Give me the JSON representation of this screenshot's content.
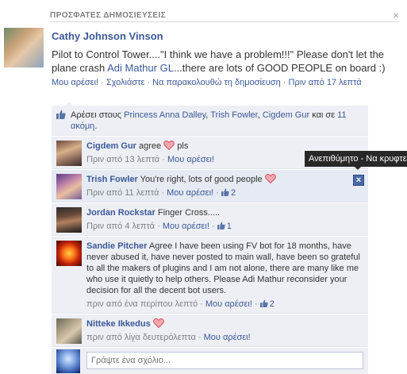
{
  "section": {
    "title": "ΠΡΟΣΦΑΤΕΣ ΔΗΜΟΣΙΕΥΣΕΙΣ",
    "close_glyph": "×"
  },
  "post": {
    "author": "Cathy Johnson Vinson",
    "text_before": "Pilot to Control Tower....\"I think we have a problem!!!\" Please don't let the plane crash ",
    "mention": "Adi Mathur GL",
    "text_after": "...there are lots of GOOD PEOPLE on board :)",
    "actions": {
      "like": "Μου αρέσει!",
      "comment": "Σχολιάστε",
      "follow": "Να παρακολουθώ τη δημοσίευση",
      "time": "Πριν από 17 λεπτά",
      "sep": " · "
    }
  },
  "likes": {
    "prefix": "Αρέσει στους ",
    "people": [
      "Princess Anna Dalley",
      "Trish Fowler",
      "Cigdem Gur"
    ],
    "comma": ", ",
    "and_text": " και σε ",
    "others": "11 ακόμη",
    "suffix": "."
  },
  "comments": [
    {
      "author": "Cigdem Gur",
      "text": " agree ",
      "after_heart": " pls",
      "time": "Πριν από 13 λεπτά",
      "like": "Μου αρέσει!",
      "count": ""
    },
    {
      "author": "Trish Fowler",
      "text": " You're right, lots of good people ",
      "after_heart": "",
      "time": "Πριν από 11 λεπτά",
      "like": "Μου αρέσει!",
      "count": "2"
    },
    {
      "author": "Jordan Rockstar",
      "text": " Finger Cross.....",
      "after_heart": "",
      "time": "Πριν από 4 λεπτά",
      "like": "Μου αρέσει!",
      "count": "1"
    },
    {
      "author": "Sandie Pitcher",
      "text": " Agree I have been using FV bot for 18 months, have never abused it, have never posted to main wall, have been so grateful to all the makers of plugins and I am not alone, there are many like me who use it quietly to help others. Please Adi Mathur reconsider your decision for all the decent bot users.",
      "after_heart": "",
      "time": "πριν από ένα περίπου λεπτό",
      "like": "Μου αρέσει!",
      "count": "2"
    },
    {
      "author": "Nitteke Ikkedus",
      "text": " ",
      "after_heart": "",
      "time": "πριν από λίγα δευτερόλεπτα",
      "like": "Μου αρέσει!",
      "count": ""
    }
  ],
  "tooltip": {
    "text": "Ανεπιθύμητο - Να κρυφτεί"
  },
  "hide_glyph": "×",
  "compose": {
    "placeholder": "Γράψτε ένα σχόλιο..."
  },
  "colors": {
    "link": "#3b5998",
    "ufi_bg": "#edeff4",
    "heart": "#e0525e"
  }
}
